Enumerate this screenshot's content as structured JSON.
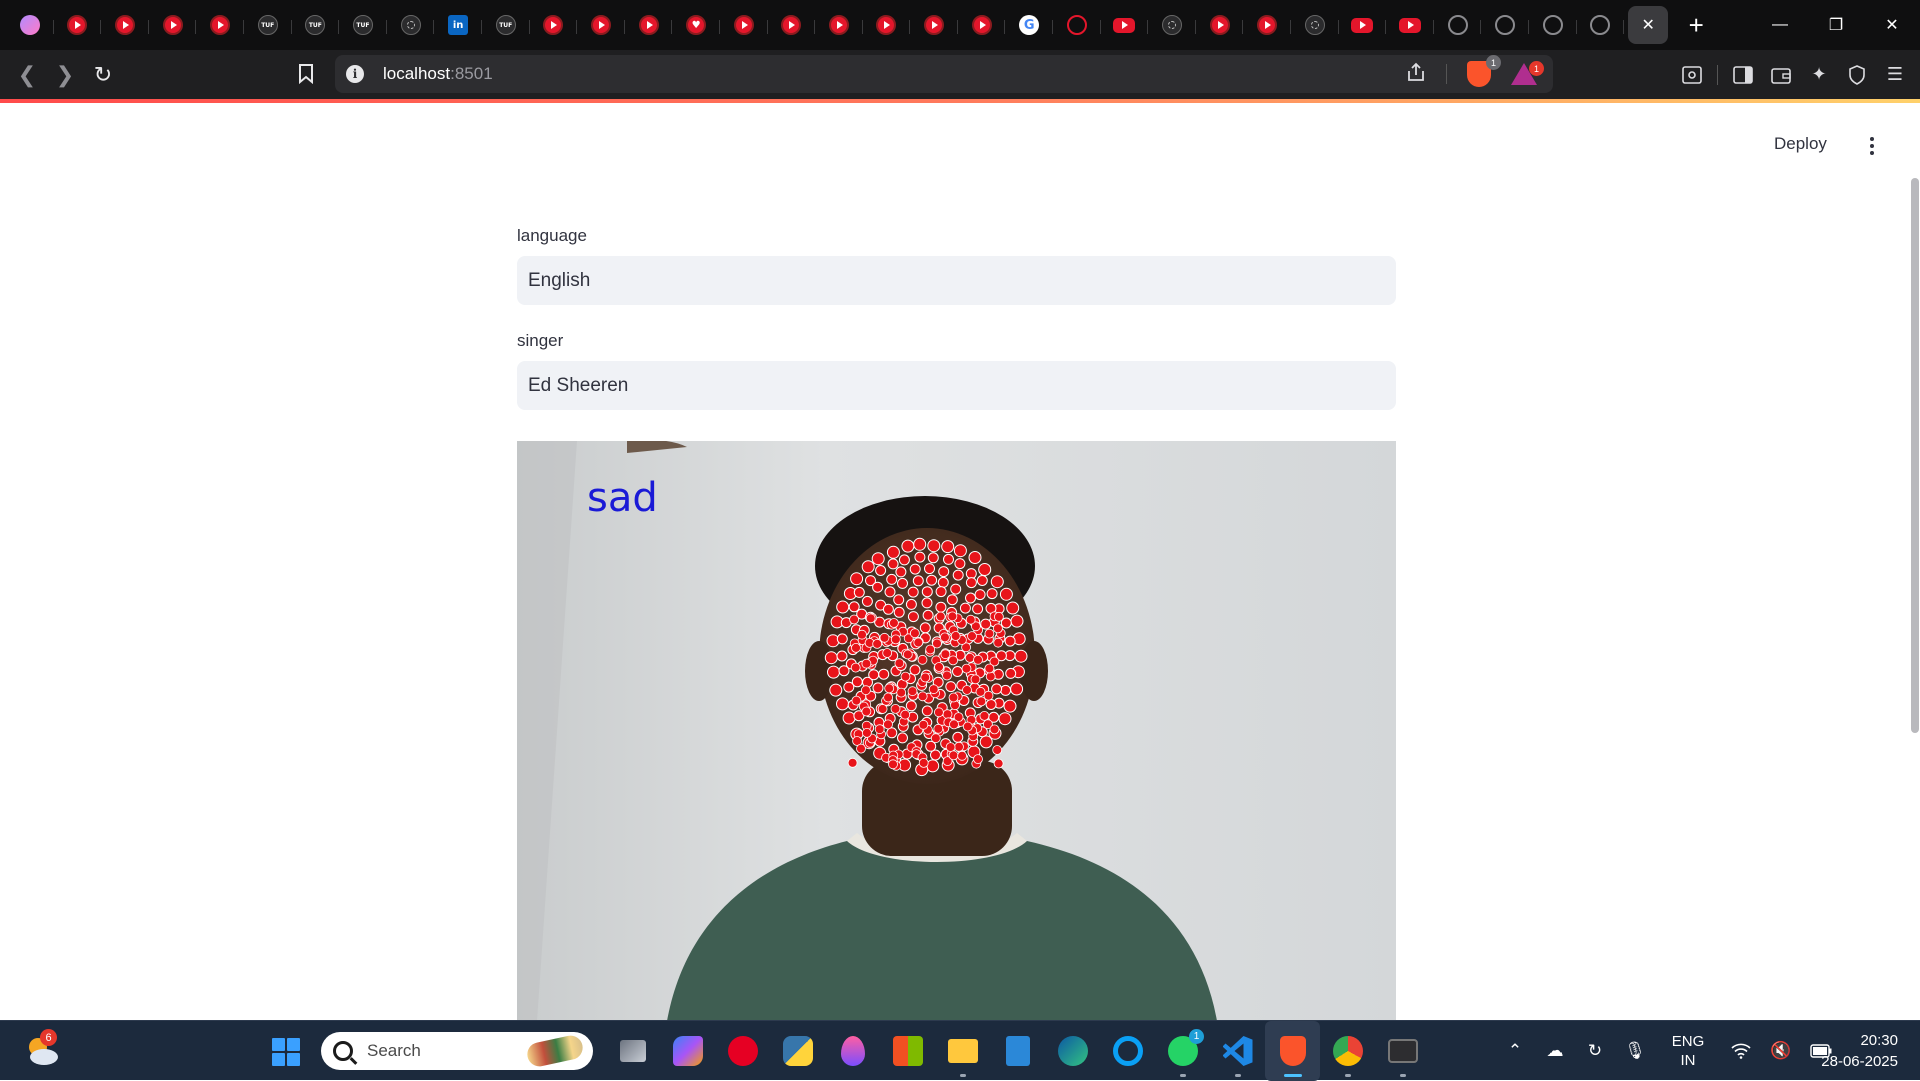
{
  "browser": {
    "tabs": [
      {
        "icon": "gem"
      },
      {
        "icon": "yt"
      },
      {
        "icon": "yt"
      },
      {
        "icon": "yt"
      },
      {
        "icon": "yt"
      },
      {
        "icon": "tuf"
      },
      {
        "icon": "tuf"
      },
      {
        "icon": "tuf"
      },
      {
        "icon": "dot"
      },
      {
        "icon": "li"
      },
      {
        "icon": "tuf"
      },
      {
        "icon": "yt"
      },
      {
        "icon": "yt"
      },
      {
        "icon": "yt"
      },
      {
        "icon": "heart"
      },
      {
        "icon": "yt"
      },
      {
        "icon": "yt"
      },
      {
        "icon": "yt"
      },
      {
        "icon": "yt"
      },
      {
        "icon": "yt"
      },
      {
        "icon": "yt"
      },
      {
        "icon": "g"
      },
      {
        "icon": "outline"
      },
      {
        "icon": "ytr"
      },
      {
        "icon": "dot"
      },
      {
        "icon": "yt"
      },
      {
        "icon": "yt"
      },
      {
        "icon": "dot"
      },
      {
        "icon": "ytr"
      },
      {
        "icon": "ytr"
      },
      {
        "icon": "globe"
      },
      {
        "icon": "globe"
      },
      {
        "icon": "globe"
      },
      {
        "icon": "globe"
      }
    ],
    "tab_text": {
      "tuf": "TUF",
      "li": "in",
      "g": "G"
    },
    "active_tab_close": "✕",
    "new_tab": "+",
    "url_host": "localhost",
    "url_port": ":8501",
    "brave_badge": "1",
    "rewards_badge": "1"
  },
  "app": {
    "deploy_label": "Deploy",
    "language_label": "language",
    "language_value": "English",
    "singer_label": "singer",
    "singer_value": "Ed Sheeren",
    "emotion_text": "sad",
    "landmark_color": "#e8141a",
    "emotion_color": "#1a1ad6"
  },
  "taskbar": {
    "weather_badge": "6",
    "search_placeholder": "Search",
    "whatsapp_badge": "1",
    "lang_line1": "ENG",
    "lang_line2": "IN",
    "time": "20:30",
    "date": "28-06-2025"
  }
}
